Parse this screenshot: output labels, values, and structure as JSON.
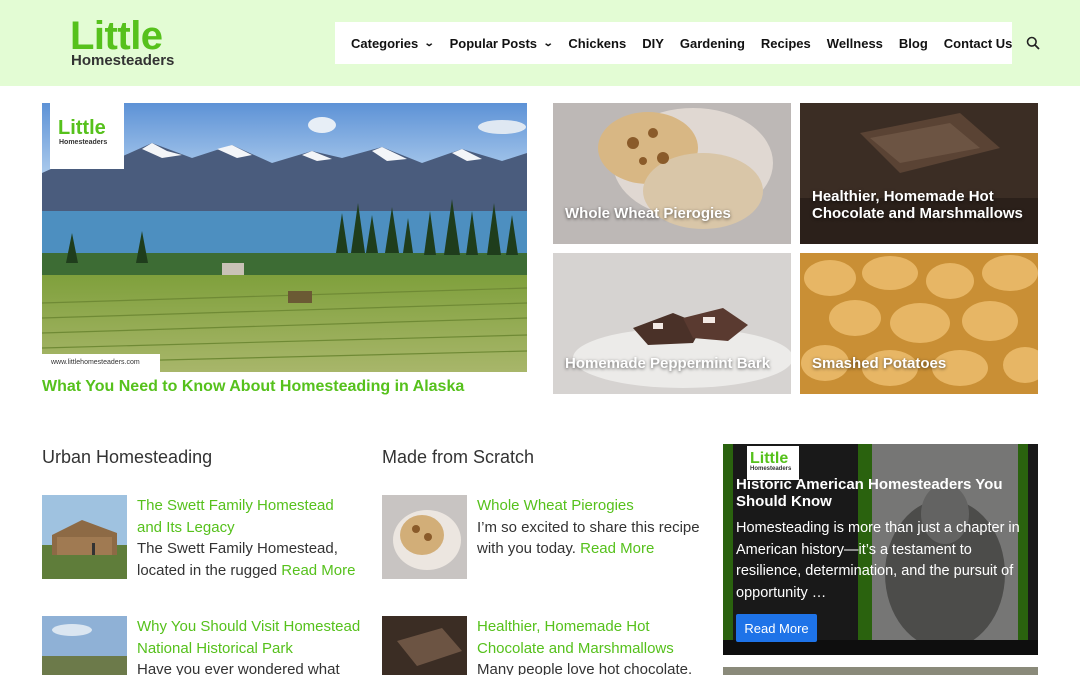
{
  "brand": {
    "line1": "Little",
    "line2": "Homesteaders"
  },
  "nav": {
    "items": [
      {
        "label": "Categories",
        "dropdown": true
      },
      {
        "label": "Popular Posts",
        "dropdown": true
      },
      {
        "label": "Chickens",
        "dropdown": false
      },
      {
        "label": "DIY",
        "dropdown": false
      },
      {
        "label": "Gardening",
        "dropdown": false
      },
      {
        "label": "Recipes",
        "dropdown": false
      },
      {
        "label": "Wellness",
        "dropdown": false
      },
      {
        "label": "Blog",
        "dropdown": false
      },
      {
        "label": "Contact Us",
        "dropdown": false
      }
    ],
    "search_icon": "search-icon"
  },
  "hero": {
    "title": "What You Need to Know About Homesteading in Alaska",
    "tag_line1": "Little",
    "tag_line2": "Homesteaders",
    "url": "www.littlehomesteaders.com"
  },
  "tiles": [
    {
      "title": "Whole Wheat Pierogies"
    },
    {
      "title": "Healthier, Homemade Hot Chocolate and Marshmallows"
    },
    {
      "title": "Homemade Peppermint Bark"
    },
    {
      "title": "Smashed Potatoes"
    }
  ],
  "urban": {
    "heading": "Urban Homesteading",
    "posts": [
      {
        "title": "The Swett Family Homestead and Its Legacy",
        "excerpt": "The Swett Family Homestead, located in the rugged",
        "more": "Read More"
      },
      {
        "title": "Why You Should Visit Homestead National Historical Park",
        "excerpt": "Have you ever wondered what life",
        "more": ""
      }
    ]
  },
  "scratch": {
    "heading": "Made from Scratch",
    "posts": [
      {
        "title": "Whole Wheat Pierogies",
        "excerpt": "I’m so excited to share this recipe with you today.",
        "more": "Read More"
      },
      {
        "title": "Healthier, Homemade Hot Chocolate and Marshmallows",
        "excerpt": "Many people love hot chocolate.",
        "more": ""
      }
    ]
  },
  "feature_card": {
    "logo_line1": "Little",
    "logo_line2": "Homesteaders",
    "title": "Historic American Homesteaders You Should Know",
    "text": "Homesteading is more than just a chapter in American history—it’s a testament to resilience, determination, and the pursuit of opportunity …",
    "button": "Read More"
  },
  "colors": {
    "header_bg": "#e3fcd4",
    "accent": "#56c11c",
    "button": "#1e73e8"
  }
}
